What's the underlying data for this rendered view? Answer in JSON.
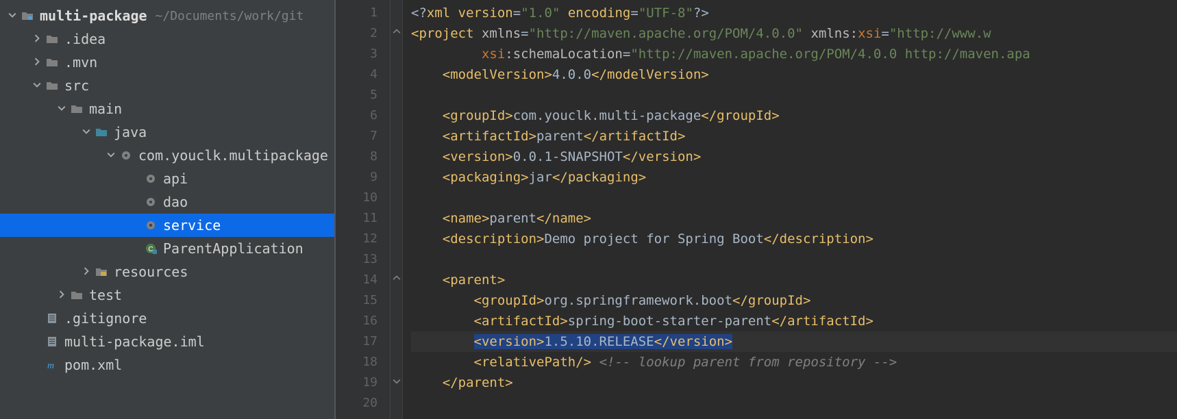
{
  "project_tree": {
    "root": {
      "name": "multi-package",
      "hint": "~/Documents/work/git"
    },
    "nodes": [
      {
        "indent": 0,
        "chev": "down",
        "icon": "module-folder",
        "label": "multi-package",
        "bold": true,
        "hint": "~/Documents/work/git"
      },
      {
        "indent": 1,
        "chev": "right",
        "icon": "folder",
        "label": ".idea"
      },
      {
        "indent": 1,
        "chev": "right",
        "icon": "folder",
        "label": ".mvn"
      },
      {
        "indent": 1,
        "chev": "down",
        "icon": "folder",
        "label": "src"
      },
      {
        "indent": 2,
        "chev": "down",
        "icon": "folder",
        "label": "main"
      },
      {
        "indent": 3,
        "chev": "down",
        "icon": "source-folder",
        "label": "java"
      },
      {
        "indent": 4,
        "chev": "down",
        "icon": "package",
        "label": "com.youclk.multipackage"
      },
      {
        "indent": 5,
        "chev": "",
        "icon": "package",
        "label": "api"
      },
      {
        "indent": 5,
        "chev": "",
        "icon": "package",
        "label": "dao"
      },
      {
        "indent": 5,
        "chev": "",
        "icon": "package",
        "label": "service",
        "selected": true
      },
      {
        "indent": 5,
        "chev": "",
        "icon": "class",
        "label": "ParentApplication"
      },
      {
        "indent": 3,
        "chev": "right",
        "icon": "resources",
        "label": "resources"
      },
      {
        "indent": 2,
        "chev": "right",
        "icon": "folder",
        "label": "test"
      },
      {
        "indent": 1,
        "chev": "",
        "icon": "file",
        "label": ".gitignore"
      },
      {
        "indent": 1,
        "chev": "",
        "icon": "file",
        "label": "multi-package.iml"
      },
      {
        "indent": 1,
        "chev": "",
        "icon": "maven",
        "label": "pom.xml"
      }
    ]
  },
  "editor": {
    "current_line": 17,
    "lines": [
      {
        "n": 1,
        "fold": "",
        "segments": [
          [
            "txt",
            "<?"
          ],
          [
            "tag",
            "xml version"
          ],
          [
            "txt",
            "="
          ],
          [
            "str",
            "\"1.0\""
          ],
          [
            "txt",
            " "
          ],
          [
            "tag",
            "encoding"
          ],
          [
            "txt",
            "="
          ],
          [
            "str",
            "\"UTF-8\""
          ],
          [
            "txt",
            "?>"
          ]
        ]
      },
      {
        "n": 2,
        "fold": "open",
        "segments": [
          [
            "tag",
            "<project "
          ],
          [
            "attr",
            "xmlns"
          ],
          [
            "txt",
            "="
          ],
          [
            "str",
            "\"http://maven.apache.org/POM/4.0.0\""
          ],
          [
            "txt",
            " "
          ],
          [
            "attr",
            "xmlns:"
          ],
          [
            "ns",
            "xsi"
          ],
          [
            "txt",
            "="
          ],
          [
            "str",
            "\"http://www.w"
          ]
        ]
      },
      {
        "n": 3,
        "fold": "",
        "segments": [
          [
            "txt",
            "         "
          ],
          [
            "ns",
            "xsi"
          ],
          [
            "attr",
            ":schemaLocation"
          ],
          [
            "txt",
            "="
          ],
          [
            "str",
            "\"http://maven.apache.org/POM/4.0.0 http://maven.apa"
          ]
        ]
      },
      {
        "n": 4,
        "fold": "",
        "segments": [
          [
            "txt",
            "    "
          ],
          [
            "tag",
            "<modelVersion>"
          ],
          [
            "txt",
            "4.0.0"
          ],
          [
            "tag",
            "</modelVersion>"
          ]
        ]
      },
      {
        "n": 5,
        "fold": "",
        "segments": [
          [
            "txt",
            ""
          ]
        ]
      },
      {
        "n": 6,
        "fold": "",
        "segments": [
          [
            "txt",
            "    "
          ],
          [
            "tag",
            "<groupId>"
          ],
          [
            "txt",
            "com.youclk.multi-package"
          ],
          [
            "tag",
            "</groupId>"
          ]
        ]
      },
      {
        "n": 7,
        "fold": "",
        "segments": [
          [
            "txt",
            "    "
          ],
          [
            "tag",
            "<artifactId>"
          ],
          [
            "txt",
            "parent"
          ],
          [
            "tag",
            "</artifactId>"
          ]
        ]
      },
      {
        "n": 8,
        "fold": "",
        "segments": [
          [
            "txt",
            "    "
          ],
          [
            "tag",
            "<version>"
          ],
          [
            "txt",
            "0.0.1-SNAPSHOT"
          ],
          [
            "tag",
            "</version>"
          ]
        ]
      },
      {
        "n": 9,
        "fold": "",
        "segments": [
          [
            "txt",
            "    "
          ],
          [
            "tag",
            "<packaging>"
          ],
          [
            "txt",
            "jar"
          ],
          [
            "tag",
            "</packaging>"
          ]
        ]
      },
      {
        "n": 10,
        "fold": "",
        "segments": [
          [
            "txt",
            ""
          ]
        ]
      },
      {
        "n": 11,
        "fold": "",
        "segments": [
          [
            "txt",
            "    "
          ],
          [
            "tag",
            "<name>"
          ],
          [
            "txt",
            "parent"
          ],
          [
            "tag",
            "</name>"
          ]
        ]
      },
      {
        "n": 12,
        "fold": "",
        "segments": [
          [
            "txt",
            "    "
          ],
          [
            "tag",
            "<description>"
          ],
          [
            "txt",
            "Demo project for Spring Boot"
          ],
          [
            "tag",
            "</description>"
          ]
        ]
      },
      {
        "n": 13,
        "fold": "",
        "segments": [
          [
            "txt",
            ""
          ]
        ]
      },
      {
        "n": 14,
        "fold": "open",
        "segments": [
          [
            "txt",
            "    "
          ],
          [
            "tag",
            "<parent>"
          ]
        ]
      },
      {
        "n": 15,
        "fold": "",
        "segments": [
          [
            "txt",
            "        "
          ],
          [
            "tag",
            "<groupId>"
          ],
          [
            "txt",
            "org.springframework.boot"
          ],
          [
            "tag",
            "</groupId>"
          ]
        ]
      },
      {
        "n": 16,
        "fold": "",
        "segments": [
          [
            "txt",
            "        "
          ],
          [
            "tag",
            "<artifactId>"
          ],
          [
            "txt",
            "spring-boot-starter-parent"
          ],
          [
            "tag",
            "</artifactId>"
          ]
        ]
      },
      {
        "n": 17,
        "fold": "",
        "segments": [
          [
            "txt",
            "        "
          ],
          [
            "sel-tag",
            "<version>"
          ],
          [
            "sel-txt",
            "1.5.10.RELEASE"
          ],
          [
            "sel-tag",
            "</version>"
          ]
        ]
      },
      {
        "n": 18,
        "fold": "",
        "segments": [
          [
            "txt",
            "        "
          ],
          [
            "tag",
            "<relativePath/>"
          ],
          [
            "txt",
            " "
          ],
          [
            "cmt",
            "<!-- lookup parent from repository -->"
          ]
        ]
      },
      {
        "n": 19,
        "fold": "close",
        "segments": [
          [
            "txt",
            "    "
          ],
          [
            "tag",
            "</parent>"
          ]
        ]
      },
      {
        "n": 20,
        "fold": "",
        "segments": [
          [
            "txt",
            ""
          ]
        ]
      }
    ]
  }
}
